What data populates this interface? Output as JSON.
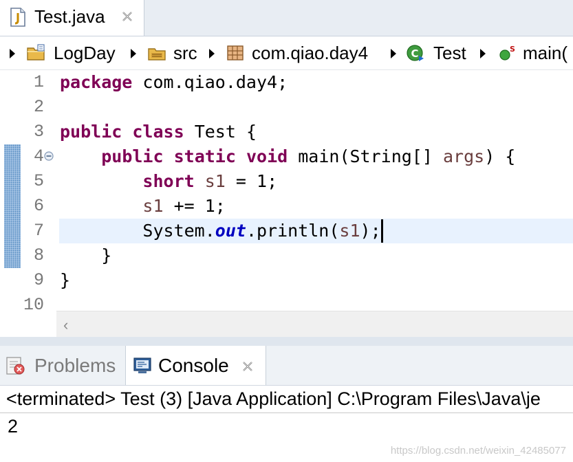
{
  "editor_tab": {
    "label": "Test.java",
    "icon": "java-file-icon"
  },
  "breadcrumb": {
    "items": [
      {
        "label": "LogDay",
        "icon": "project-folder-icon"
      },
      {
        "label": "src",
        "icon": "source-folder-icon"
      },
      {
        "label": "com.qiao.day4",
        "icon": "package-icon"
      },
      {
        "label": "Test",
        "icon": "class-icon"
      },
      {
        "label": "main(",
        "icon": "static-method-icon"
      }
    ]
  },
  "editor": {
    "line_numbers": [
      "1",
      "2",
      "3",
      "4",
      "5",
      "6",
      "7",
      "8",
      "9",
      "10"
    ],
    "current_line": 7,
    "code": {
      "l1_kw": "package",
      "l1_rest": " com.qiao.day4;",
      "l3_kw1": "public",
      "l3_kw2": "class",
      "l3_rest": " Test {",
      "l4_indent": "    ",
      "l4_kw1": "public",
      "l4_kw2": "static",
      "l4_kw3": "void",
      "l4_mid": " main(String[] ",
      "l4_var": "args",
      "l4_end": ") {",
      "l5_indent": "        ",
      "l5_kw": "short",
      "l5_var": "s1",
      "l5_end": " = 1;",
      "l6_indent": "        ",
      "l6_var": "s1",
      "l6_end": " += 1;",
      "l7_indent": "        ",
      "l7_a": "System.",
      "l7_field": "out",
      "l7_b": ".println(",
      "l7_var": "s1",
      "l7_c": ");",
      "l8": "    }",
      "l9": "}"
    },
    "colors": {
      "keyword": "#7f0055",
      "local_var": "#6a3e3e",
      "static_field": "#0000c0",
      "current_line_bg": "#e8f2fe"
    }
  },
  "bottom_tabs": {
    "problems": {
      "label": "Problems",
      "icon": "problems-icon"
    },
    "console": {
      "label": "Console",
      "icon": "console-icon"
    }
  },
  "console": {
    "header": "<terminated> Test (3) [Java Application] C:\\Program Files\\Java\\je",
    "output": "2"
  },
  "watermark": "https://blog.csdn.net/weixin_42485077"
}
